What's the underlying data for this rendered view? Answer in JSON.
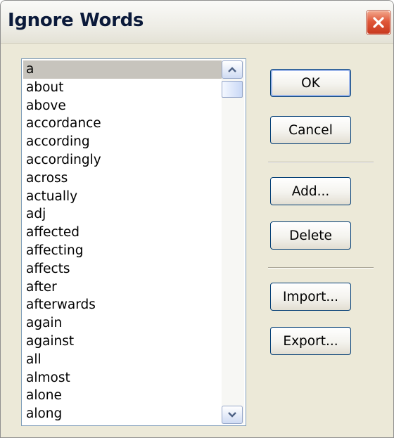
{
  "window": {
    "title": "Ignore Words"
  },
  "word_list": {
    "items": [
      "a",
      "about",
      "above",
      "accordance",
      "according",
      "accordingly",
      "across",
      "actually",
      "adj",
      "affected",
      "affecting",
      "affects",
      "after",
      "afterwards",
      "again",
      "against",
      "all",
      "almost",
      "alone",
      "along"
    ],
    "selected": "a"
  },
  "buttons": {
    "ok": "OK",
    "cancel": "Cancel",
    "add": "Add...",
    "delete": "Delete",
    "import": "Import...",
    "export": "Export..."
  },
  "icons": {
    "close": "close-icon",
    "scroll_up": "chevron-up-icon",
    "scroll_down": "chevron-down-icon"
  },
  "colors": {
    "close_button": "#e0583a",
    "selection": "#c7c4bd",
    "dialog_background": "#ece9d8"
  }
}
